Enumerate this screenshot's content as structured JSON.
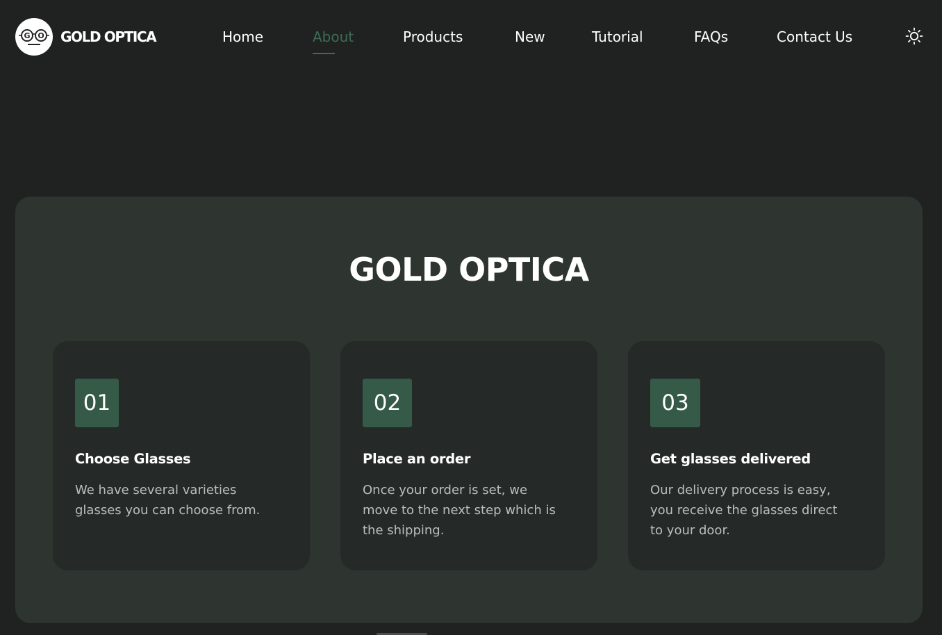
{
  "header": {
    "brand": "GOLD OPTICA",
    "logo_icon": "glasses-logo-icon",
    "nav": [
      {
        "label": "Home"
      },
      {
        "label": "About",
        "active": true
      },
      {
        "label": "Products"
      },
      {
        "label": "New"
      },
      {
        "label": "Tutorial"
      },
      {
        "label": "FAQs"
      },
      {
        "label": "Contact Us"
      }
    ],
    "theme_icon": "sun-icon"
  },
  "about": {
    "title": "GOLD OPTICA",
    "steps": [
      {
        "number": "01",
        "title": "Choose Glasses",
        "text": "We have several varieties glasses you can choose from."
      },
      {
        "number": "02",
        "title": "Place an order",
        "text": "Once your order is set, we move to the next step which is the shipping."
      },
      {
        "number": "03",
        "title": "Get glasses delivered",
        "text": "Our delivery process is easy, you receive the glasses direct to your door."
      }
    ]
  },
  "colors": {
    "background": "#1f2221",
    "panel": "#2e3531",
    "card": "#252928",
    "accent": "#3d6b55",
    "badge": "#355a48"
  }
}
